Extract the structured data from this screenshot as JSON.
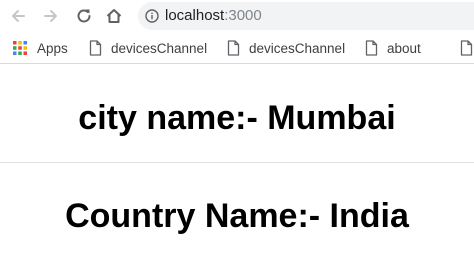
{
  "browser": {
    "address_host": "localhost",
    "address_port": ":3000"
  },
  "bookmarks": {
    "apps_label": "Apps",
    "items": [
      {
        "label": "devicesChannel",
        "icon": "page-icon"
      },
      {
        "label": "devicesChannel",
        "icon": "page-icon"
      },
      {
        "label": "about",
        "icon": "page-icon"
      }
    ]
  },
  "page": {
    "city_heading": "city name:- Mumbai",
    "country_heading": "Country Name:- India"
  },
  "icons": {
    "back": "arrow-left-icon",
    "forward": "arrow-right-icon",
    "reload": "reload-icon",
    "home": "home-icon",
    "info": "info-icon",
    "apps": "apps-grid-icon"
  }
}
